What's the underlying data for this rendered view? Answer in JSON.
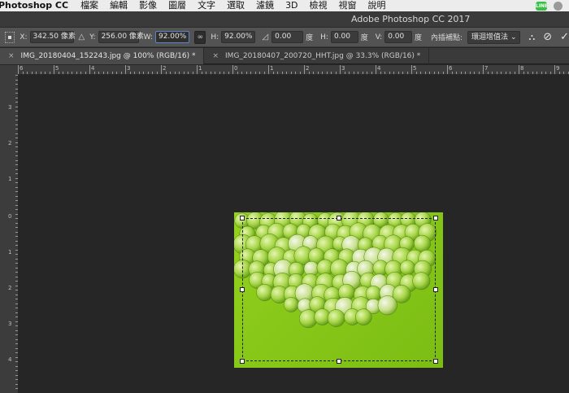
{
  "menubar": {
    "app_name": "Photoshop CC",
    "items": [
      "檔案",
      "編輯",
      "影像",
      "圖層",
      "文字",
      "選取",
      "濾鏡",
      "3D",
      "檢視",
      "視窗",
      "說明"
    ],
    "line_badge": "LINE"
  },
  "titlebar": {
    "title": "Adobe Photoshop CC 2017"
  },
  "options": {
    "x_label": "X:",
    "x_value": "342.50 像素",
    "y_label": "Y:",
    "y_value": "256.00 像素",
    "w_label": "W:",
    "w_value": "92.00%",
    "h_label": "H:",
    "h_value": "92.00%",
    "angle_value": "0.00",
    "angle_unit": "度",
    "hskew_label": "H:",
    "hskew_value": "0.00",
    "hskew_unit": "度",
    "vskew_label": "V:",
    "vskew_value": "0.00",
    "vskew_unit": "度",
    "interp_label": "內插補點:",
    "interp_value": "環迴增值法"
  },
  "tabs": [
    {
      "close": "×",
      "label": "IMG_20180404_152243.jpg @ 100% (RGB/16) *"
    },
    {
      "close": "×",
      "label": "IMG_20180407_200720_HHT.jpg @ 33.3% (RGB/16) *"
    }
  ],
  "ruler_top_labels": [
    "6",
    "5",
    "4",
    "3",
    "2",
    "1",
    "0",
    "1",
    "2",
    "3",
    "4",
    "5",
    "6",
    "7",
    "8",
    "9"
  ],
  "ruler_left_labels": [
    "3",
    "2",
    "1",
    "0",
    "1",
    "2",
    "3",
    "4"
  ],
  "colors": {
    "accent": "#5b84c4",
    "photo_bg": "#8cc81a",
    "grape": "#a8d64a"
  }
}
